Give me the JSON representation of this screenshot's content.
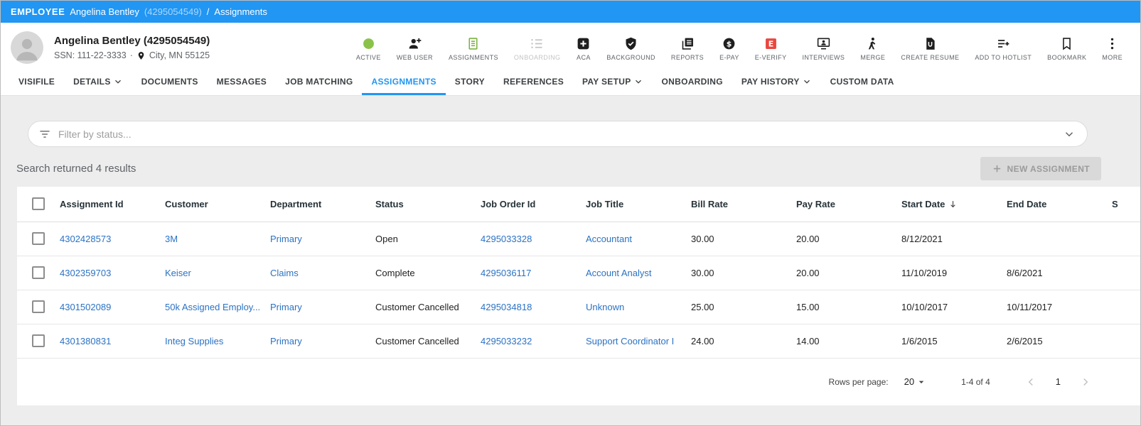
{
  "topbar": {
    "entity": "EMPLOYEE",
    "name": "Angelina Bentley",
    "id": "(4295054549)",
    "divider": "/",
    "section": "Assignments"
  },
  "header": {
    "title": "Angelina Bentley (4295054549)",
    "ssn": "SSN: 111-22-3333",
    "dot": "·",
    "location": "City, MN 55125",
    "actions": [
      {
        "label": "ACTIVE",
        "icon": "active-status-icon",
        "state": "normal"
      },
      {
        "label": "WEB USER",
        "icon": "web-user-icon",
        "state": "normal"
      },
      {
        "label": "ASSIGNMENTS",
        "icon": "assignments-icon",
        "state": "normal"
      },
      {
        "label": "ONBOARDING",
        "icon": "onboarding-icon",
        "state": "disabled"
      },
      {
        "label": "ACA",
        "icon": "aca-icon",
        "state": "normal"
      },
      {
        "label": "BACKGROUND",
        "icon": "background-icon",
        "state": "normal"
      },
      {
        "label": "REPORTS",
        "icon": "reports-icon",
        "state": "normal"
      },
      {
        "label": "E-PAY",
        "icon": "e-pay-icon",
        "state": "normal"
      },
      {
        "label": "E-VERIFY",
        "icon": "e-verify-icon",
        "state": "normal"
      },
      {
        "label": "INTERVIEWS",
        "icon": "interviews-icon",
        "state": "normal"
      },
      {
        "label": "MERGE",
        "icon": "merge-icon",
        "state": "normal"
      },
      {
        "label": "CREATE RESUME",
        "icon": "create-resume-icon",
        "state": "normal"
      },
      {
        "label": "ADD TO HOTLIST",
        "icon": "add-to-hotlist-icon",
        "state": "normal"
      },
      {
        "label": "BOOKMARK",
        "icon": "bookmark-icon",
        "state": "normal"
      },
      {
        "label": "MORE",
        "icon": "more-icon",
        "state": "normal"
      }
    ]
  },
  "tabs": [
    {
      "label": "VISIFILE",
      "dropdown": false,
      "active": false
    },
    {
      "label": "DETAILS",
      "dropdown": true,
      "active": false
    },
    {
      "label": "DOCUMENTS",
      "dropdown": false,
      "active": false
    },
    {
      "label": "MESSAGES",
      "dropdown": false,
      "active": false
    },
    {
      "label": "JOB MATCHING",
      "dropdown": false,
      "active": false
    },
    {
      "label": "ASSIGNMENTS",
      "dropdown": false,
      "active": true
    },
    {
      "label": "STORY",
      "dropdown": false,
      "active": false
    },
    {
      "label": "REFERENCES",
      "dropdown": false,
      "active": false
    },
    {
      "label": "PAY SETUP",
      "dropdown": true,
      "active": false
    },
    {
      "label": "ONBOARDING",
      "dropdown": false,
      "active": false
    },
    {
      "label": "PAY HISTORY",
      "dropdown": true,
      "active": false
    },
    {
      "label": "CUSTOM DATA",
      "dropdown": false,
      "active": false
    }
  ],
  "filter": {
    "placeholder": "Filter by status..."
  },
  "results": {
    "summary": "Search returned 4 results"
  },
  "toolbar": {
    "new_assignment_label": "NEW ASSIGNMENT"
  },
  "table": {
    "columns": [
      "Assignment Id",
      "Customer",
      "Department",
      "Status",
      "Job Order Id",
      "Job Title",
      "Bill Rate",
      "Pay Rate",
      "Start Date",
      "End Date",
      "S"
    ],
    "sort_column": "Start Date",
    "sort_direction": "desc",
    "rows": [
      {
        "assignment_id": "4302428573",
        "customer": "3M",
        "department": "Primary",
        "status": "Open",
        "job_order_id": "4295033328",
        "job_title": "Accountant",
        "bill_rate": "30.00",
        "pay_rate": "20.00",
        "start_date": "8/12/2021",
        "end_date": ""
      },
      {
        "assignment_id": "4302359703",
        "customer": "Keiser",
        "department": "Claims",
        "status": "Complete",
        "job_order_id": "4295036117",
        "job_title": "Account Analyst",
        "bill_rate": "30.00",
        "pay_rate": "20.00",
        "start_date": "11/10/2019",
        "end_date": "8/6/2021"
      },
      {
        "assignment_id": "4301502089",
        "customer": "50k Assigned Employ...",
        "department": "Primary",
        "status": "Customer Cancelled",
        "job_order_id": "4295034818",
        "job_title": "Unknown",
        "bill_rate": "25.00",
        "pay_rate": "15.00",
        "start_date": "10/10/2017",
        "end_date": "10/11/2017"
      },
      {
        "assignment_id": "4301380831",
        "customer": "Integ Supplies",
        "department": "Primary",
        "status": "Customer Cancelled",
        "job_order_id": "4295033232",
        "job_title": "Support Coordinator I",
        "bill_rate": "24.00",
        "pay_rate": "14.00",
        "start_date": "1/6/2015",
        "end_date": "2/6/2015"
      }
    ]
  },
  "pagination": {
    "rows_per_page_label": "Rows per page:",
    "rows_per_page": "20",
    "range": "1-4 of 4",
    "page": "1"
  },
  "colors": {
    "topbar_blue": "#2196F3",
    "link_blue": "#2b72c4",
    "active_green": "#8BC34A",
    "everify_red": "#E8473F"
  }
}
